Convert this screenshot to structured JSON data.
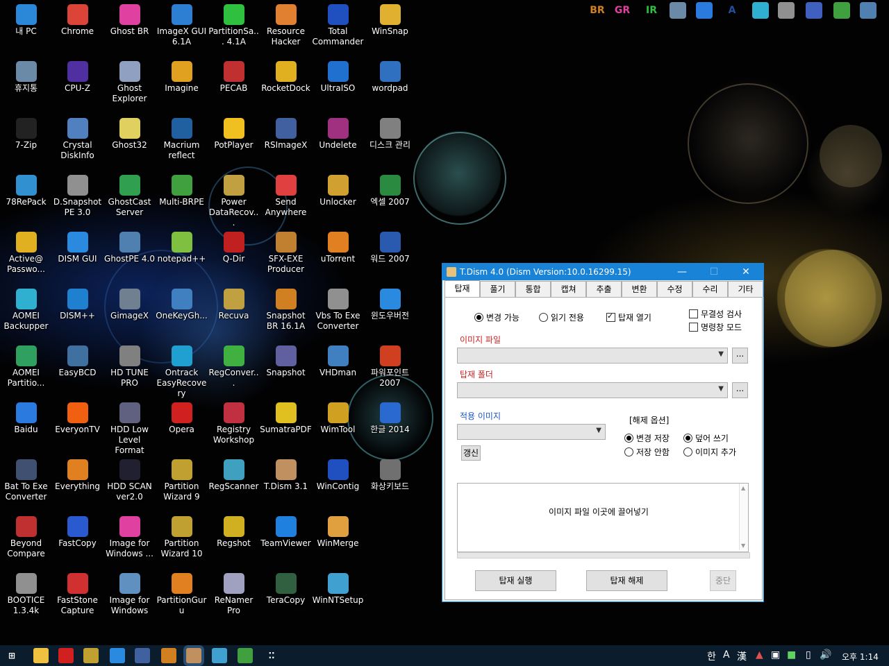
{
  "desktop": {
    "icons": [
      {
        "label": "내 PC",
        "icon": "this-pc-icon",
        "color": "#2b88d8"
      },
      {
        "label": "Chrome",
        "icon": "chrome-icon",
        "color": "#db4437"
      },
      {
        "label": "Ghost BR",
        "icon": "ghost-br-icon",
        "color": "#e040a0"
      },
      {
        "label": "ImageX GUI 6.1A",
        "icon": "imagex-icon",
        "color": "#2d7fd3"
      },
      {
        "label": "PartitionSa... 4.1A",
        "icon": "partition-saving-icon",
        "color": "#30c040"
      },
      {
        "label": "Resource Hacker",
        "icon": "resource-hacker-icon",
        "color": "#e08030"
      },
      {
        "label": "Total Commander",
        "icon": "total-commander-icon",
        "color": "#2050c0"
      },
      {
        "label": "WinSnap",
        "icon": "winsnap-icon",
        "color": "#e0b030"
      },
      {
        "label": "휴지통",
        "icon": "recycle-bin-icon",
        "color": "#6a8aa8"
      },
      {
        "label": "CPU-Z",
        "icon": "cpu-z-icon",
        "color": "#5030a0"
      },
      {
        "label": "Ghost Explorer",
        "icon": "ghost-explorer-icon",
        "color": "#90a0c0"
      },
      {
        "label": "Imagine",
        "icon": "imagine-icon",
        "color": "#e0a020"
      },
      {
        "label": "PECAB",
        "icon": "pecab-icon",
        "color": "#c03030"
      },
      {
        "label": "RocketDock",
        "icon": "rocketdock-icon",
        "color": "#e0b020"
      },
      {
        "label": "UltraISO",
        "icon": "ultraiso-icon",
        "color": "#2070d0"
      },
      {
        "label": "wordpad",
        "icon": "wordpad-icon",
        "color": "#3070c0"
      },
      {
        "label": "7-Zip",
        "icon": "7zip-icon",
        "color": "#222222"
      },
      {
        "label": "Crystal DiskInfo",
        "icon": "crystal-diskinfo-icon",
        "color": "#5080c0"
      },
      {
        "label": "Ghost32",
        "icon": "ghost32-icon",
        "color": "#e0d060"
      },
      {
        "label": "Macrium reflect",
        "icon": "macrium-icon",
        "color": "#2060a0"
      },
      {
        "label": "PotPlayer",
        "icon": "potplayer-icon",
        "color": "#f0c020"
      },
      {
        "label": "RSImageX",
        "icon": "rsimagex-icon",
        "color": "#4060a0"
      },
      {
        "label": "Undelete",
        "icon": "undelete-icon",
        "color": "#a03080"
      },
      {
        "label": "디스크 관리",
        "icon": "disk-management-icon",
        "color": "#808080"
      },
      {
        "label": "78RePack",
        "icon": "78repack-icon",
        "color": "#3090d0"
      },
      {
        "label": "D.Snapshot PE 3.0",
        "icon": "dsnapshot-icon",
        "color": "#909090"
      },
      {
        "label": "GhostCast Server",
        "icon": "ghostcast-icon",
        "color": "#30a050"
      },
      {
        "label": "Multi-BRPE",
        "icon": "multi-brpe-icon",
        "color": "#40a040"
      },
      {
        "label": "Power DataRecov...",
        "icon": "power-datarecovery-icon",
        "color": "#c0a040"
      },
      {
        "label": "Send Anywhere",
        "icon": "send-anywhere-icon",
        "color": "#e04040"
      },
      {
        "label": "Unlocker",
        "icon": "unlocker-icon",
        "color": "#d0a030"
      },
      {
        "label": "엑셀 2007",
        "icon": "excel-icon",
        "color": "#2a8a40"
      },
      {
        "label": "Active@ Passwo...",
        "icon": "key-icon",
        "color": "#e0b020"
      },
      {
        "label": "DISM GUI",
        "icon": "windows-icon",
        "color": "#2a8ae0"
      },
      {
        "label": "GhostPE 4.0",
        "icon": "ghostpe-icon",
        "color": "#5080b0"
      },
      {
        "label": "notepad++",
        "icon": "notepad-plus-icon",
        "color": "#80c040"
      },
      {
        "label": "Q-Dir",
        "icon": "q-dir-icon",
        "color": "#c02020"
      },
      {
        "label": "SFX-EXE Producer",
        "icon": "sfx-exe-icon",
        "color": "#c08030"
      },
      {
        "label": "uTorrent",
        "icon": "utorrent-icon",
        "color": "#e08020"
      },
      {
        "label": "워드 2007",
        "icon": "word-icon",
        "color": "#2a5ab0"
      },
      {
        "label": "AOMEI Backupper",
        "icon": "aomei-backupper-icon",
        "color": "#30b0d0"
      },
      {
        "label": "DISM++",
        "icon": "gear-icon",
        "color": "#2080d0"
      },
      {
        "label": "GimageX",
        "icon": "gimagex-icon",
        "color": "#708090"
      },
      {
        "label": "OneKeyGh...",
        "icon": "onekeyghost-icon",
        "color": "#4080c0"
      },
      {
        "label": "Recuva",
        "icon": "recuva-icon",
        "color": "#c0a040"
      },
      {
        "label": "Snapshot BR 16.1A",
        "icon": "snapshot-br-icon",
        "color": "#d08020"
      },
      {
        "label": "Vbs To Exe Converter",
        "icon": "vbs-to-exe-icon",
        "color": "#909090"
      },
      {
        "label": "윈도우버전",
        "icon": "windows-version-icon",
        "color": "#2a8ae0"
      },
      {
        "label": "AOMEI Partitio...",
        "icon": "aomei-partition-icon",
        "color": "#30a060"
      },
      {
        "label": "EasyBCD",
        "icon": "easybcd-icon",
        "color": "#4070a0"
      },
      {
        "label": "HD TUNE PRO",
        "icon": "hdtune-icon",
        "color": "#808080"
      },
      {
        "label": "Ontrack EasyRecovery",
        "icon": "ontrack-icon",
        "color": "#20a0d0"
      },
      {
        "label": "RegConver...",
        "icon": "regconverter-icon",
        "color": "#40b040"
      },
      {
        "label": "Snapshot",
        "icon": "snapshot-icon",
        "color": "#6060a0"
      },
      {
        "label": "VHDman",
        "icon": "vhdman-icon",
        "color": "#4080c0"
      },
      {
        "label": "파워포인트 2007",
        "icon": "powerpoint-icon",
        "color": "#d04020"
      },
      {
        "label": "Baidu",
        "icon": "baidu-icon",
        "color": "#2a7ae0"
      },
      {
        "label": "EveryonTV",
        "icon": "everyontv-icon",
        "color": "#f06010"
      },
      {
        "label": "HDD Low Level Format",
        "icon": "hdd-format-icon",
        "color": "#606080"
      },
      {
        "label": "Opera",
        "icon": "opera-icon",
        "color": "#d02020"
      },
      {
        "label": "Registry Workshop",
        "icon": "registry-workshop-icon",
        "color": "#c03040"
      },
      {
        "label": "SumatraPDF",
        "icon": "sumatrapdf-icon",
        "color": "#e0c020"
      },
      {
        "label": "WimTool",
        "icon": "wimtool-icon",
        "color": "#d0a020"
      },
      {
        "label": "한글 2014",
        "icon": "hangul-icon",
        "color": "#2a6ad0"
      },
      {
        "label": "Bat To Exe Converter",
        "icon": "bat-to-exe-icon",
        "color": "#405070"
      },
      {
        "label": "Everything",
        "icon": "search-icon",
        "color": "#e08020"
      },
      {
        "label": "HDD SCAN ver2.0",
        "icon": "hdd-scan-icon",
        "color": "#202030"
      },
      {
        "label": "Partition Wizard 9",
        "icon": "partition-wizard-icon",
        "color": "#c0a030"
      },
      {
        "label": "RegScanner",
        "icon": "regscanner-icon",
        "color": "#40a0c0"
      },
      {
        "label": "T.Dism 3.1",
        "icon": "tdism-icon",
        "color": "#c09060"
      },
      {
        "label": "WinContig",
        "icon": "wincontig-icon",
        "color": "#2050c0"
      },
      {
        "label": "화상키보드",
        "icon": "keyboard-icon",
        "color": "#707070"
      },
      {
        "label": "Beyond Compare",
        "icon": "beyond-compare-icon",
        "color": "#c03030"
      },
      {
        "label": "FastCopy",
        "icon": "fastcopy-icon",
        "color": "#2a5ad0"
      },
      {
        "label": "Image for Windows ...",
        "icon": "image-for-windows-icon",
        "color": "#e040a0"
      },
      {
        "label": "Partition Wizard 10",
        "icon": "partition-wizard-icon",
        "color": "#c0a030"
      },
      {
        "label": "Regshot",
        "icon": "regshot-icon",
        "color": "#d0b020"
      },
      {
        "label": "TeamViewer",
        "icon": "teamviewer-icon",
        "color": "#2080e0"
      },
      {
        "label": "WinMerge",
        "icon": "winmerge-icon",
        "color": "#e0a040"
      },
      {
        "label": "",
        "icon": "",
        "color": ""
      },
      {
        "label": "BOOTICE 1.3.4k",
        "icon": "bootice-icon",
        "color": "#909090"
      },
      {
        "label": "FastStone Capture",
        "icon": "faststone-icon",
        "color": "#d03030"
      },
      {
        "label": "Image for Windows",
        "icon": "image-for-windows-2-icon",
        "color": "#6090c0"
      },
      {
        "label": "PartitionGuru",
        "icon": "partitionguru-icon",
        "color": "#e08020"
      },
      {
        "label": "ReNamer Pro",
        "icon": "renamer-icon",
        "color": "#a0a0c0"
      },
      {
        "label": "TeraCopy",
        "icon": "teracopy-icon",
        "color": "#306040"
      },
      {
        "label": "WinNTSetup",
        "icon": "winntsetup-icon",
        "color": "#40a0d0"
      },
      {
        "label": "",
        "icon": "",
        "color": ""
      }
    ]
  },
  "topbar": {
    "items": [
      {
        "text": "BR",
        "icon": "snapshot-br-icon",
        "color": "#d08020"
      },
      {
        "text": "GR",
        "icon": "ghost-br-icon",
        "color": "#e040a0"
      },
      {
        "text": "IR",
        "icon": "image-for-windows-icon",
        "color": "#30c040"
      },
      {
        "text": "",
        "icon": "computer-icon",
        "color": "#6a8aa8"
      },
      {
        "text": "",
        "icon": "refresh-icon",
        "color": "#2a7ae0"
      },
      {
        "text": "A",
        "icon": "a-icon",
        "color": "#2050a0"
      },
      {
        "text": "",
        "icon": "aomei-icon",
        "color": "#30b0d0"
      },
      {
        "text": "",
        "icon": "drive-icon",
        "color": "#909090"
      },
      {
        "text": "",
        "icon": "gear-icon",
        "color": "#4060c0"
      },
      {
        "text": "",
        "icon": "disk-icon",
        "color": "#40a040"
      },
      {
        "text": "",
        "icon": "backup-icon",
        "color": "#5080b0"
      }
    ]
  },
  "window": {
    "title": "T.Dism 4.0 (Dism Version:10.0.16299.15)",
    "minimize": "—",
    "maximize": "☐",
    "close": "✕",
    "tabs": [
      "탑재",
      "풀기",
      "통합",
      "캡쳐",
      "추출",
      "변환",
      "수정",
      "수리",
      "기타"
    ],
    "active_tab": 0,
    "mode": {
      "writable_label": "변경 가능",
      "readonly_label": "읽기 전용",
      "open_mount_label": "탑재 열기",
      "selected": "writable",
      "open_mount_checked": true
    },
    "options": {
      "integrity_check_label": "무결성 검사",
      "integrity_check_checked": false,
      "cmd_mode_label": "명령창 모드",
      "cmd_mode_checked": false
    },
    "image_file": {
      "label": "이미지 파일",
      "value": "",
      "browse": "..."
    },
    "mount_folder": {
      "label": "탑재 폴더",
      "value": "",
      "browse": "..."
    },
    "apply_image": {
      "label": "적용 이미지",
      "value": "",
      "refresh": "갱신"
    },
    "unmount_options": {
      "label": "[해제 옵션]",
      "save_label": "변경 저장",
      "discard_label": "저장 안함",
      "overwrite_label": "덮어 쓰기",
      "append_label": "이미지 추가",
      "save_selected": "save",
      "write_selected": "overwrite"
    },
    "dropzone_text": "이미지 파일 이곳에 끌어넣기",
    "buttons": {
      "mount": "탑재 실행",
      "unmount": "탑재 해제",
      "stop": "중단"
    }
  },
  "taskbar": {
    "items": [
      {
        "icon": "windows-start-icon",
        "color": "#ffffff"
      },
      {
        "icon": "file-explorer-icon",
        "color": "#f0c040"
      },
      {
        "icon": "opera-icon",
        "color": "#d02020"
      },
      {
        "icon": "partition-wizard-icon",
        "color": "#c0a030"
      },
      {
        "icon": "dism-gui-icon",
        "color": "#2a8ae0"
      },
      {
        "icon": "rsimagex-icon",
        "color": "#4060a0"
      },
      {
        "icon": "snapshot-br-icon",
        "color": "#d08020"
      },
      {
        "icon": "tdism-icon",
        "color": "#c09060"
      },
      {
        "icon": "document-icon",
        "color": "#40a0d0"
      },
      {
        "icon": "multi-brpe-icon",
        "color": "#40a040"
      },
      {
        "icon": "dots-icon",
        "color": "#ffffff"
      }
    ],
    "tray": {
      "ime_han": "한",
      "ime_a": "A",
      "ime_hanja": "漢",
      "time": "오후 1:14"
    }
  }
}
